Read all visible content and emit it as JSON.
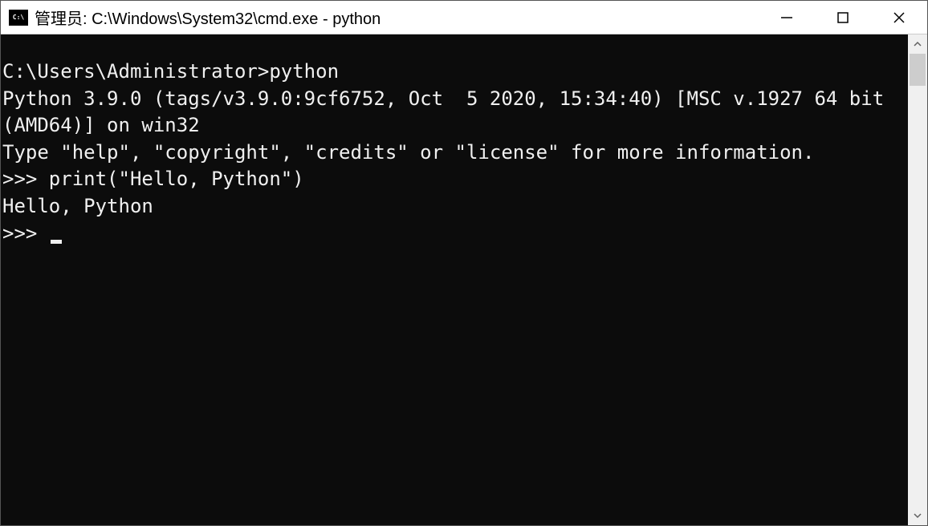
{
  "window": {
    "title": "管理员: C:\\Windows\\System32\\cmd.exe - python",
    "icon_label": "C:\\"
  },
  "terminal": {
    "lines": [
      "C:\\Users\\Administrator>python",
      "Python 3.9.0 (tags/v3.9.0:9cf6752, Oct  5 2020, 15:34:40) [MSC v.1927 64 bit (AMD64)] on win32",
      "Type \"help\", \"copyright\", \"credits\" or \"license\" for more information.",
      ">>> print(\"Hello, Python\")",
      "Hello, Python",
      ">>> "
    ]
  }
}
